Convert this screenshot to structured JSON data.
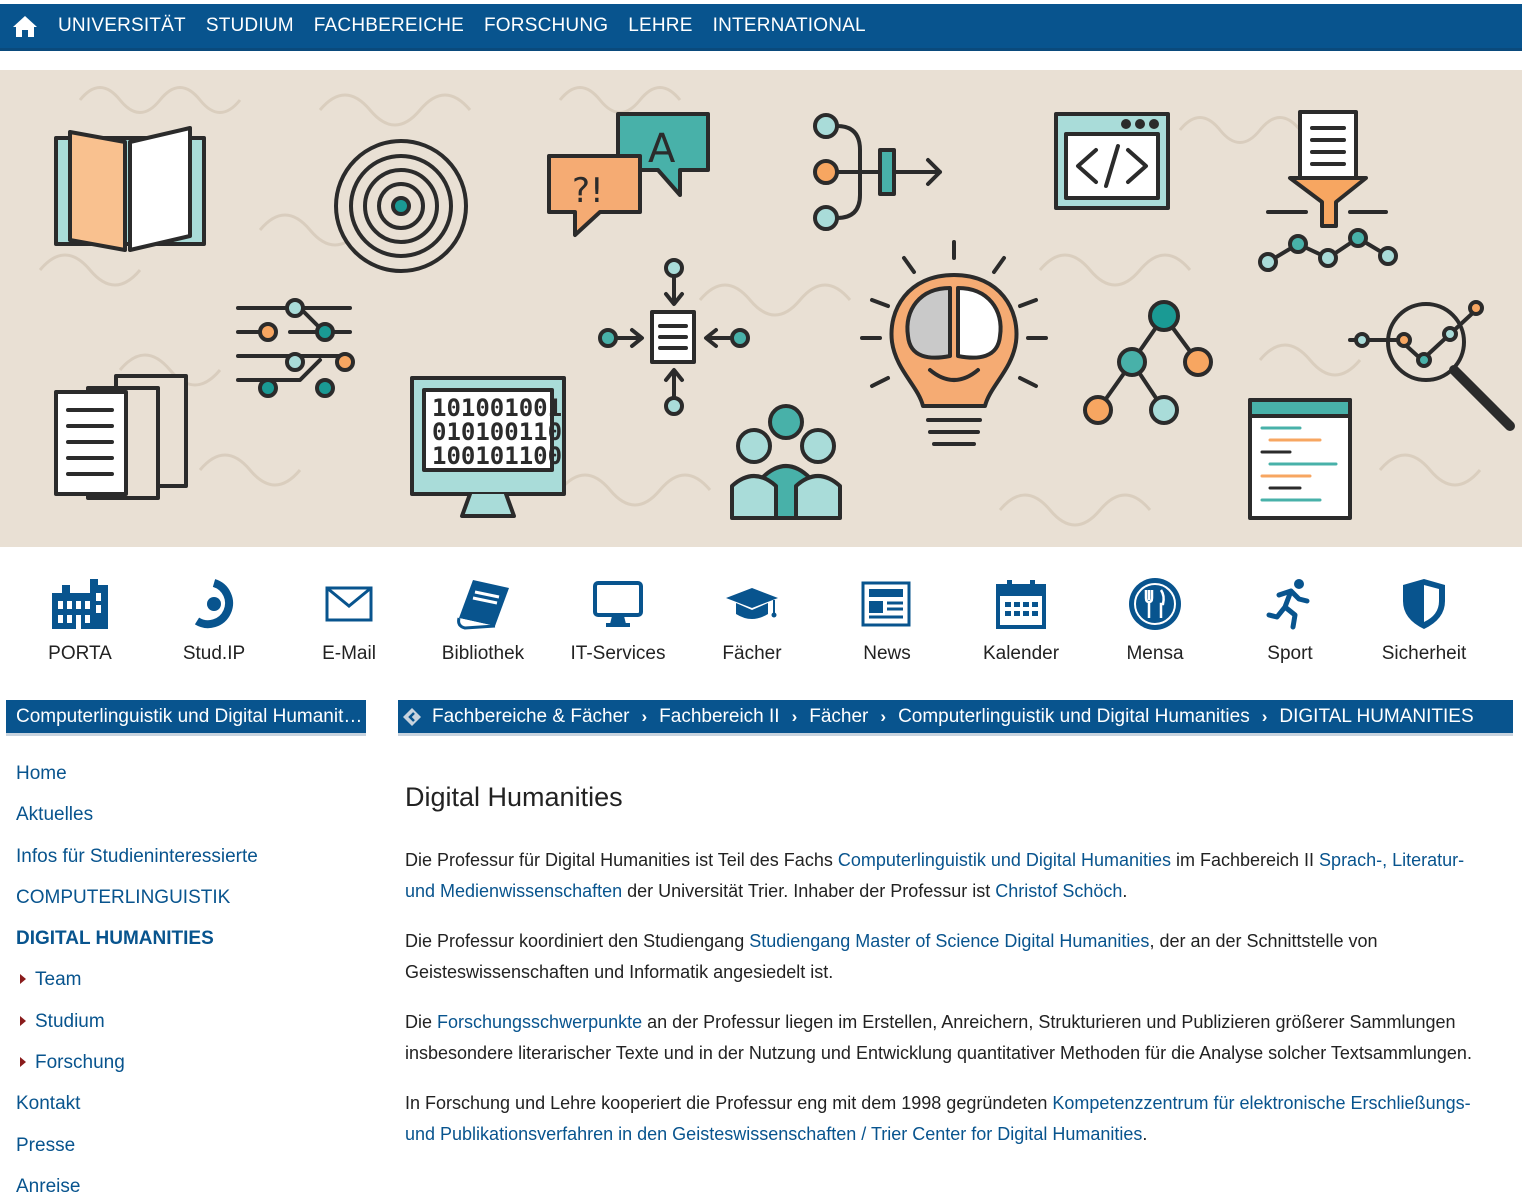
{
  "topnav": {
    "items": [
      "UNIVERSITÄT",
      "STUDIUM",
      "FACHBEREICHE",
      "FORSCHUNG",
      "LEHRE",
      "INTERNATIONAL"
    ]
  },
  "hero": {
    "binary": [
      "101001001",
      "010100110",
      "100101100"
    ],
    "bubble_a": "A",
    "bubble_q": "?!"
  },
  "quicklinks": [
    {
      "label": "PORTA",
      "icon": "building-icon"
    },
    {
      "label": "Stud.IP",
      "icon": "studip-icon"
    },
    {
      "label": "E-Mail",
      "icon": "mail-icon"
    },
    {
      "label": "Bibliothek",
      "icon": "book-icon"
    },
    {
      "label": "IT-Services",
      "icon": "monitor-icon"
    },
    {
      "label": "Fächer",
      "icon": "graduation-cap-icon"
    },
    {
      "label": "News",
      "icon": "newspaper-icon"
    },
    {
      "label": "Kalender",
      "icon": "calendar-icon"
    },
    {
      "label": "Mensa",
      "icon": "cutlery-icon"
    },
    {
      "label": "Sport",
      "icon": "runner-icon"
    },
    {
      "label": "Sicherheit",
      "icon": "shield-icon"
    }
  ],
  "sidebar": {
    "heading": "Computerlinguistik und Digital Humanities",
    "items": [
      {
        "label": "Home"
      },
      {
        "label": "Aktuelles"
      },
      {
        "label": "Infos für Studieninteressierte"
      },
      {
        "label": "COMPUTERLINGUISTIK"
      },
      {
        "label": "DIGITAL HUMANITIES"
      },
      {
        "label": "Team"
      },
      {
        "label": "Studium"
      },
      {
        "label": "Forschung"
      },
      {
        "label": "Kontakt"
      },
      {
        "label": "Presse"
      },
      {
        "label": "Anreise"
      }
    ]
  },
  "breadcrumb": [
    "Fachbereiche & Fächer",
    "Fachbereich II",
    "Fächer",
    "Computerlinguistik und Digital Humanities",
    "DIGITAL HUMANITIES"
  ],
  "content": {
    "title": "Digital Humanities",
    "p1": {
      "t1": "Die Professur für Digital Humanities ist Teil des Fachs ",
      "l1": "Computerlinguistik und Digital Humanities",
      "t2": " im Fachbereich II ",
      "l2": "Sprach-, Literatur- und Medienwissenschaften",
      "t3": " der Universität Trier. Inhaber der Professur ist ",
      "l3": "Christof Schöch",
      "t4": "."
    },
    "p2": {
      "t1": "Die Professur koordiniert den Studiengang ",
      "l1": "Studiengang Master of Science Digital Humanities",
      "t2": ", der an der Schnittstelle von Geisteswissenschaften und Informatik angesiedelt ist."
    },
    "p3": {
      "t1": "Die ",
      "l1": "Forschungsschwerpunkte",
      "t2": " an der Professur liegen im Erstellen, Anreichern, Strukturieren und Publizieren größerer Sammlungen insbesondere literarischer Texte und in der Nutzung und Entwicklung quantitativer Methoden für die Analyse solcher Textsammlungen."
    },
    "p4": {
      "t1": "In Forschung und Lehre kooperiert die Professur eng mit dem 1998 gegründeten ",
      "l1": "Kompetenzzentrum für elektronische Erschließungs- und Publikationsverfahren in den Geisteswissenschaften / Trier Center for Digital Humanities",
      "t2": "."
    }
  },
  "colors": {
    "primary": "#08548e",
    "teal": "#1a9a94",
    "light_teal": "#a9dcd9",
    "orange": "#f7a661",
    "hero_bg": "#e9e0d4",
    "arrow_red": "#8a1c1c"
  }
}
